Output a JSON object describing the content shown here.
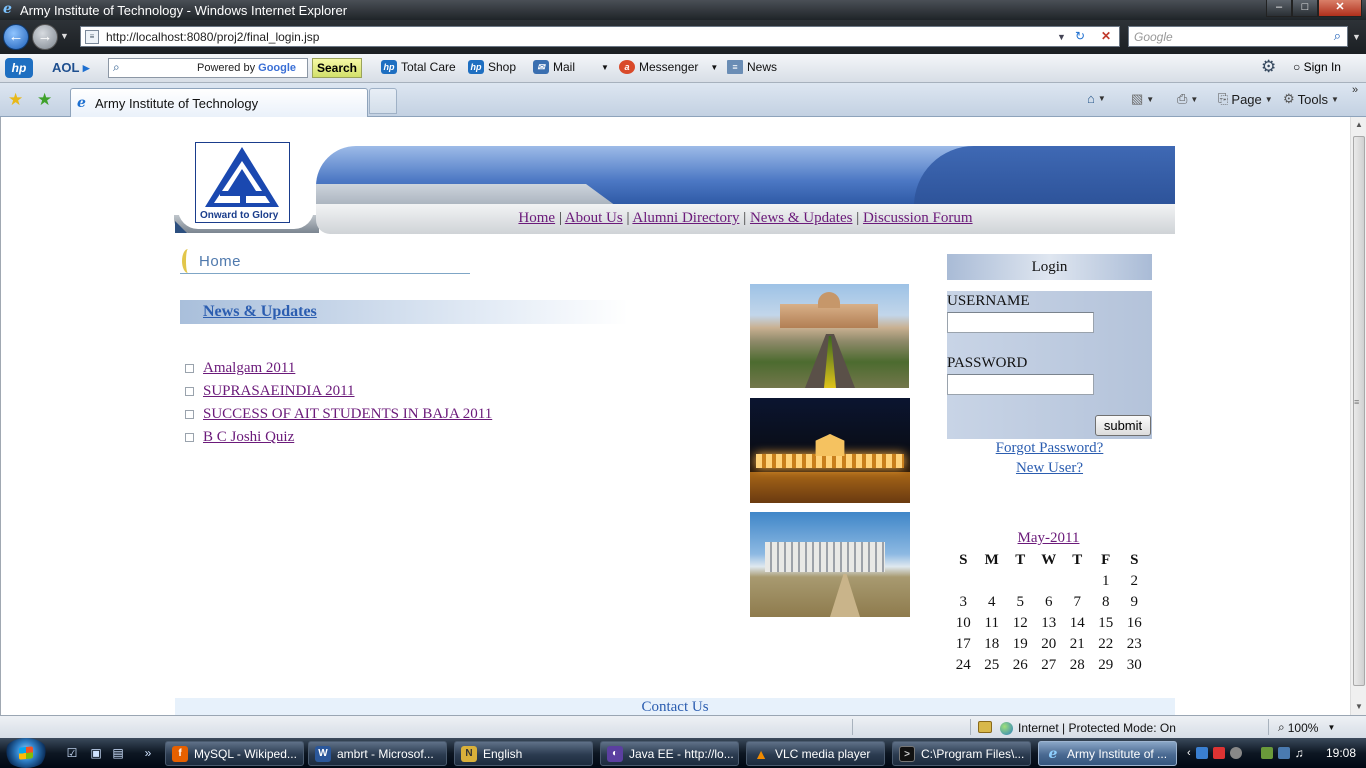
{
  "window": {
    "title": "Army Institute of Technology - Windows Internet Explorer",
    "controls": [
      "minimize",
      "maximize",
      "close"
    ]
  },
  "addressbar": {
    "url": "http://localhost:8080/proj2/final_login.jsp",
    "search_placeholder": "Google"
  },
  "toolbar": {
    "aol_label": "AOL",
    "powered_by": "Powered by",
    "google_label": "Google",
    "search_button": "Search",
    "items": [
      {
        "label": "Total Care",
        "icon": "hp-icon"
      },
      {
        "label": "Shop",
        "icon": "hp-icon"
      },
      {
        "label": "Mail",
        "icon": "mail-icon"
      },
      {
        "label": "Messenger",
        "icon": "aim-icon"
      },
      {
        "label": "News",
        "icon": "news-icon"
      }
    ],
    "sign_in": "Sign In"
  },
  "tabs": {
    "active_tab": "Army Institute of Technology"
  },
  "commandbar": {
    "page_label": "Page",
    "tools_label": "Tools"
  },
  "site": {
    "motto": "Onward to Glory",
    "nav": [
      "Home",
      "About Us",
      "Alumni Directory",
      "News & Updates",
      "Discussion Forum"
    ],
    "section_title": "Home",
    "news_header": "News & Updates",
    "news_items": [
      "Amalgam 2011",
      "SUPRASAEINDIA 2011",
      "SUCCESS OF AIT STUDENTS IN BAJA 2011",
      "B C Joshi Quiz"
    ],
    "login": {
      "title": "Login",
      "username_label": "USERNAME",
      "password_label": "PASSWORD",
      "submit_label": "submit",
      "forgot_label": "Forgot Password?",
      "newuser_label": "New User?"
    },
    "calendar": {
      "month": "May-2011",
      "weekdays": [
        "S",
        "M",
        "T",
        "W",
        "T",
        "F",
        "S"
      ],
      "weeks": [
        [
          "",
          "",
          "",
          "",
          "",
          "1",
          "2"
        ],
        [
          "3",
          "4",
          "5",
          "6",
          "7",
          "8",
          "9"
        ],
        [
          "10",
          "11",
          "12",
          "13",
          "14",
          "15",
          "16"
        ],
        [
          "17",
          "18",
          "19",
          "20",
          "21",
          "22",
          "23"
        ],
        [
          "24",
          "25",
          "26",
          "27",
          "28",
          "29",
          "30"
        ]
      ]
    },
    "footer": "Contact Us"
  },
  "statusbar": {
    "zone": "Internet | Protected Mode: On",
    "zoom": "100%"
  },
  "taskbar": {
    "tasks": [
      {
        "label": "MySQL - Wikiped...",
        "icon": "firefox-icon",
        "color": "#e66000"
      },
      {
        "label": "ambrt - Microsof...",
        "icon": "word-icon",
        "color": "#2b579a"
      },
      {
        "label": "English",
        "icon": "notepad-icon",
        "color": "#d9b03a"
      },
      {
        "label": "Java EE - http://lo...",
        "icon": "eclipse-icon",
        "color": "#5b3fa0"
      },
      {
        "label": "VLC media player",
        "icon": "vlc-icon",
        "color": "#f08a00"
      },
      {
        "label": "C:\\Program Files\\...",
        "icon": "cmd-icon",
        "color": "#111111"
      },
      {
        "label": "Army Institute of ...",
        "icon": "ie-icon",
        "color": "#1d6fd0"
      }
    ],
    "clock": "19:08"
  }
}
